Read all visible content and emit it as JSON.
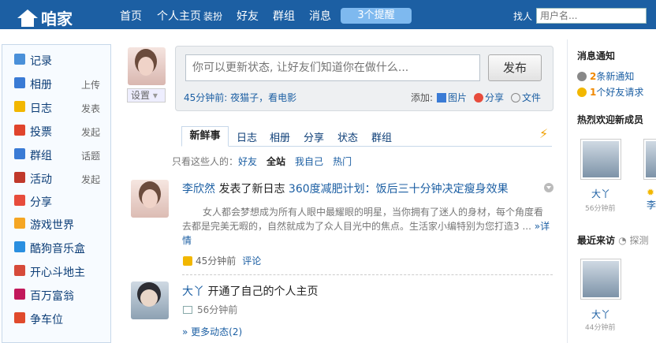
{
  "topbar": {
    "logo": "咱家",
    "nav": [
      "首页",
      "个人主页",
      "装扮",
      "好友",
      "群组",
      "消息"
    ],
    "alerts": "3个提醒",
    "find_people": "找人",
    "search_placeholder": "用户名..."
  },
  "sidebar": {
    "items": [
      {
        "label": "记录",
        "action": "",
        "icon": "bubble-icon",
        "color": "#4a90d9"
      },
      {
        "label": "相册",
        "action": "上传",
        "icon": "photo-icon",
        "color": "#3a7bd5"
      },
      {
        "label": "日志",
        "action": "发表",
        "icon": "journal-icon",
        "color": "#f2b700"
      },
      {
        "label": "投票",
        "action": "发起",
        "icon": "chart-icon",
        "color": "#e0442c"
      },
      {
        "label": "群组",
        "action": "话题",
        "icon": "people-icon",
        "color": "#3a7bd5"
      },
      {
        "label": "活动",
        "action": "发起",
        "icon": "calendar-icon",
        "color": "#c0392b"
      },
      {
        "label": "分享",
        "action": "",
        "icon": "hearts-icon",
        "color": "#e74c3c"
      },
      {
        "label": "游戏世界",
        "action": "",
        "icon": "game-icon",
        "color": "#f5a623"
      },
      {
        "label": "酷狗音乐盒",
        "action": "",
        "icon": "music-icon",
        "color": "#2a8fe0"
      },
      {
        "label": "开心斗地主",
        "action": "",
        "icon": "cards-icon",
        "color": "#d64a3a"
      },
      {
        "label": "百万富翁",
        "action": "",
        "icon": "star-icon",
        "color": "#c2185b"
      },
      {
        "label": "争车位",
        "action": "",
        "icon": "parking-icon",
        "color": "#e04a2c"
      }
    ]
  },
  "profile": {
    "settings": "设置"
  },
  "status": {
    "placeholder": "你可以更新状态, 让好友们知道你在做什么...",
    "post": "发布",
    "last_update": "45分钟前: 夜猫子，看电影",
    "add_label": "添加:",
    "attach": [
      "图片",
      "分享",
      "文件"
    ]
  },
  "tabs": {
    "active": "新鲜事",
    "items": [
      "日志",
      "相册",
      "分享",
      "状态",
      "群组"
    ]
  },
  "filter": {
    "label": "只看这些人的：",
    "options": [
      "好友",
      "全站",
      "我自己",
      "热门"
    ]
  },
  "feed": [
    {
      "name": "李欣然",
      "action": "发表了新日志",
      "article": "360度减肥计划：饭后三十分钟决定瘦身效果",
      "body": "女人都会梦想成为所有人眼中最耀眼的明星，当你拥有了迷人的身材，每个角度看去都是完美无暇的，自然就成为了众人目光中的焦点。生活家小编特别为您打造3 ...",
      "more": "»详情",
      "time": "45分钟前",
      "comment": "评论"
    },
    {
      "name": "大丫",
      "action": "开通了自己的个人主页",
      "time": "56分钟前"
    }
  ],
  "more_feed": "» 更多动态(2)",
  "right": {
    "notice_title": "消息通知",
    "notices": [
      {
        "count": "2",
        "text": "条新通知"
      },
      {
        "count": "1",
        "text": "个好友请求"
      }
    ],
    "welcome_title": "热烈欢迎新成员",
    "welcome": [
      {
        "name": "大丫",
        "time": "56分钟前"
      },
      {
        "name": "李",
        "time": ""
      }
    ],
    "visitors_title": "最近来访",
    "visitors_action": "探测",
    "visitors": [
      {
        "name": "大丫",
        "time": "44分钟前"
      }
    ]
  }
}
